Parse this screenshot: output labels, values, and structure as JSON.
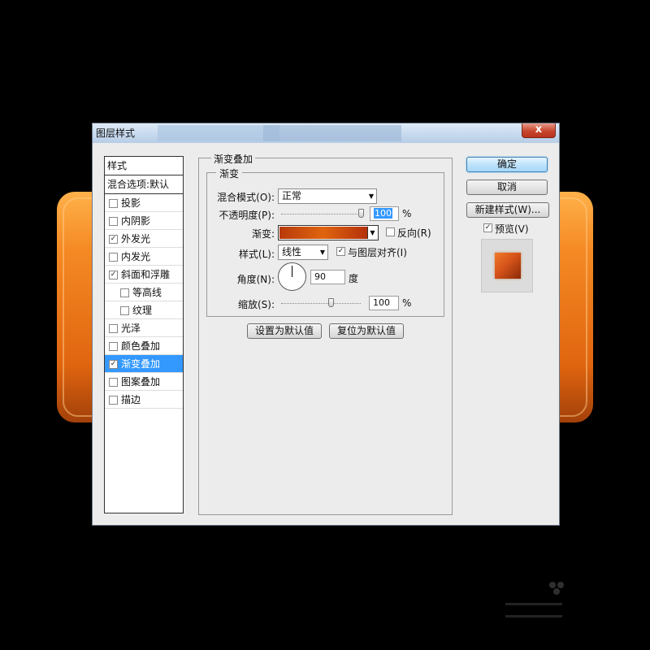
{
  "window": {
    "title": "图层样式",
    "close_label": "x"
  },
  "style_list": {
    "header": "样式",
    "blend_options": "混合选项:默认",
    "items": [
      {
        "label": "投影",
        "checked": false
      },
      {
        "label": "内阴影",
        "checked": false
      },
      {
        "label": "外发光",
        "checked": true
      },
      {
        "label": "内发光",
        "checked": false
      },
      {
        "label": "斜面和浮雕",
        "checked": true
      },
      {
        "label": "等高线",
        "checked": false
      },
      {
        "label": "纹理",
        "checked": false
      },
      {
        "label": "光泽",
        "checked": false
      },
      {
        "label": "颜色叠加",
        "checked": false
      },
      {
        "label": "渐变叠加",
        "checked": true,
        "selected": true
      },
      {
        "label": "图案叠加",
        "checked": false
      },
      {
        "label": "描边",
        "checked": false
      }
    ],
    "check_mark": "✓"
  },
  "panel": {
    "group_title": "渐变叠加",
    "subgroup_title": "渐变",
    "blend_mode_label": "混合模式(O):",
    "blend_mode_value": "正常",
    "opacity_label": "不透明度(P):",
    "opacity_value": "100",
    "opacity_unit": "%",
    "gradient_label": "渐变:",
    "reverse_label": "反向(R)",
    "reverse_checked": false,
    "style_label": "样式(L):",
    "style_value": "线性",
    "align_label": "与图层对齐(I)",
    "align_checked": true,
    "angle_label": "角度(N):",
    "angle_value": "90",
    "angle_unit": "度",
    "scale_label": "缩放(S):",
    "scale_value": "100",
    "scale_unit": "%",
    "make_default": "设置为默认值",
    "reset_default": "复位为默认值"
  },
  "right": {
    "ok": "确定",
    "cancel": "取消",
    "new_style": "新建样式(W)...",
    "preview_label": "预览(V)",
    "preview_checked": true
  },
  "colors": {
    "accent_selection": "#3399ff",
    "gradient_dark": "#b73a0a",
    "gradient_light": "#e0640f",
    "bg_orange": "#f07a1a"
  }
}
